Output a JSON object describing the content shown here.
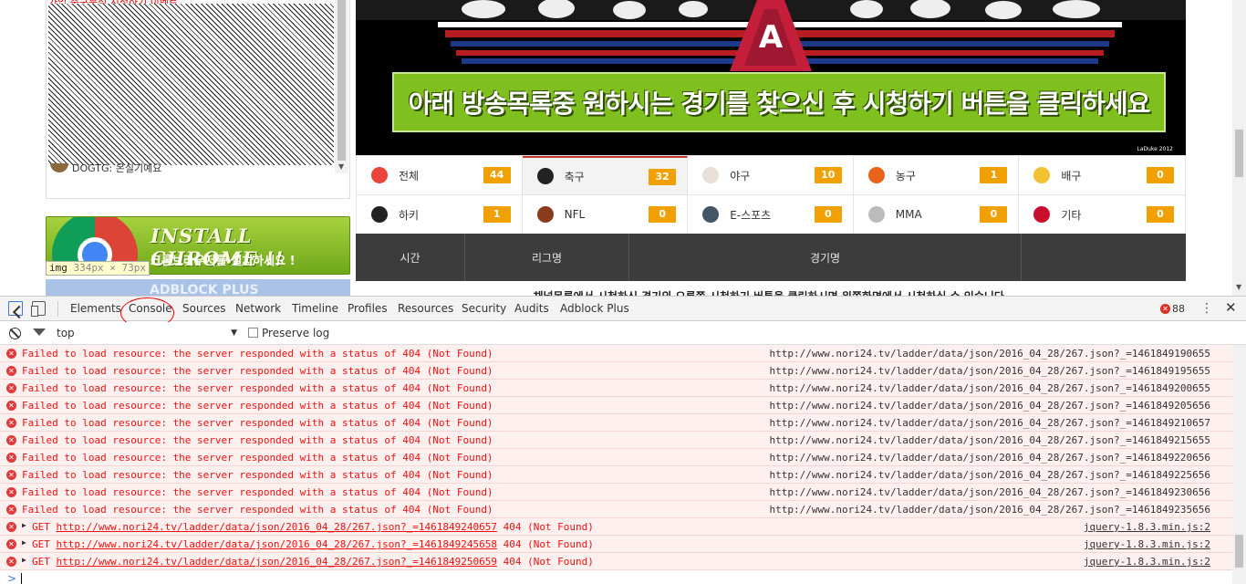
{
  "side_panel": {
    "top_text": "가입 축구분석 시청하기 이벤트",
    "item_text": "DOGTG: 온실기예요"
  },
  "chrome_banner": {
    "title": "INSTALL CHROME !!",
    "subtitle": "크롬브라우저를 설치하세요 !"
  },
  "img_tooltip": {
    "tag": "img",
    "dims": "334px × 73px"
  },
  "adblock_banner": {
    "text": "ADBLOCK PLUS"
  },
  "hero": {
    "banner_text": "아래 방송목록중 원하시는 경기를 찾으신 후 시청하기 버튼을 클릭하세요",
    "credit": "LaDuke 2012"
  },
  "categories": [
    {
      "name": "전체",
      "count": "44",
      "icon": "all-sports-icon",
      "color": "#e9463a"
    },
    {
      "name": "축구",
      "count": "32",
      "icon": "soccer-ball-icon",
      "color": "#222222"
    },
    {
      "name": "야구",
      "count": "10",
      "icon": "baseball-icon",
      "color": "#e8e0d8"
    },
    {
      "name": "농구",
      "count": "1",
      "icon": "basketball-icon",
      "color": "#e8641b"
    },
    {
      "name": "배구",
      "count": "0",
      "icon": "volleyball-icon",
      "color": "#f2c230"
    },
    {
      "name": "하키",
      "count": "1",
      "icon": "hockey-puck-icon",
      "color": "#222222"
    },
    {
      "name": "NFL",
      "count": "0",
      "icon": "football-icon",
      "color": "#8a3b1e"
    },
    {
      "name": "E-스포츠",
      "count": "0",
      "icon": "esports-icon",
      "color": "#445566"
    },
    {
      "name": "MMA",
      "count": "0",
      "icon": "mma-glove-icon",
      "color": "#bbbbbb"
    },
    {
      "name": "기타",
      "count": "0",
      "icon": "other-sports-icon",
      "color": "#c8102e"
    }
  ],
  "schedule_header": {
    "time": "시간",
    "league": "리그명",
    "match": "경기명"
  },
  "schedule_notice": "채널목록에서 시청하신 경기의 오른쪽 시청하기 버튼을 클릭하시면 왼쪽화면에서 시청하실 수 있습니다.",
  "devtools": {
    "tabs": [
      "Elements",
      "Console",
      "Sources",
      "Network",
      "Timeline",
      "Profiles",
      "Resources",
      "Security",
      "Audits",
      "Adblock Plus"
    ],
    "selected_tab": "Console",
    "error_count": "88",
    "context": "top",
    "preserve_log_label": "Preserve log",
    "accent": "#3879d9",
    "error_color": "#e11111"
  },
  "console": {
    "resource_errors": [
      {
        "message": "Failed to load resource: the server responded with a status of 404 (Not Found)",
        "source": "http://www.nori24.tv/ladder/data/json/2016_04_28/267.json?_=1461849190655"
      },
      {
        "message": "Failed to load resource: the server responded with a status of 404 (Not Found)",
        "source": "http://www.nori24.tv/ladder/data/json/2016_04_28/267.json?_=1461849195655"
      },
      {
        "message": "Failed to load resource: the server responded with a status of 404 (Not Found)",
        "source": "http://www.nori24.tv/ladder/data/json/2016_04_28/267.json?_=1461849200655"
      },
      {
        "message": "Failed to load resource: the server responded with a status of 404 (Not Found)",
        "source": "http://www.nori24.tv/ladder/data/json/2016_04_28/267.json?_=1461849205656"
      },
      {
        "message": "Failed to load resource: the server responded with a status of 404 (Not Found)",
        "source": "http://www.nori24.tv/ladder/data/json/2016_04_28/267.json?_=1461849210657"
      },
      {
        "message": "Failed to load resource: the server responded with a status of 404 (Not Found)",
        "source": "http://www.nori24.tv/ladder/data/json/2016_04_28/267.json?_=1461849215655"
      },
      {
        "message": "Failed to load resource: the server responded with a status of 404 (Not Found)",
        "source": "http://www.nori24.tv/ladder/data/json/2016_04_28/267.json?_=1461849220656"
      },
      {
        "message": "Failed to load resource: the server responded with a status of 404 (Not Found)",
        "source": "http://www.nori24.tv/ladder/data/json/2016_04_28/267.json?_=1461849225656"
      },
      {
        "message": "Failed to load resource: the server responded with a status of 404 (Not Found)",
        "source": "http://www.nori24.tv/ladder/data/json/2016_04_28/267.json?_=1461849230656"
      },
      {
        "message": "Failed to load resource: the server responded with a status of 404 (Not Found)",
        "source": "http://www.nori24.tv/ladder/data/json/2016_04_28/267.json?_=1461849235656"
      }
    ],
    "get_errors": [
      {
        "method": "GET",
        "url": "http://www.nori24.tv/ladder/data/json/2016_04_28/267.json?_=1461849240657",
        "status": "404 (Not Found)",
        "source": "jquery-1.8.3.min.js:2"
      },
      {
        "method": "GET",
        "url": "http://www.nori24.tv/ladder/data/json/2016_04_28/267.json?_=1461849245658",
        "status": "404 (Not Found)",
        "source": "jquery-1.8.3.min.js:2"
      },
      {
        "method": "GET",
        "url": "http://www.nori24.tv/ladder/data/json/2016_04_28/267.json?_=1461849250659",
        "status": "404 (Not Found)",
        "source": "jquery-1.8.3.min.js:2"
      }
    ],
    "prompt": ">"
  }
}
